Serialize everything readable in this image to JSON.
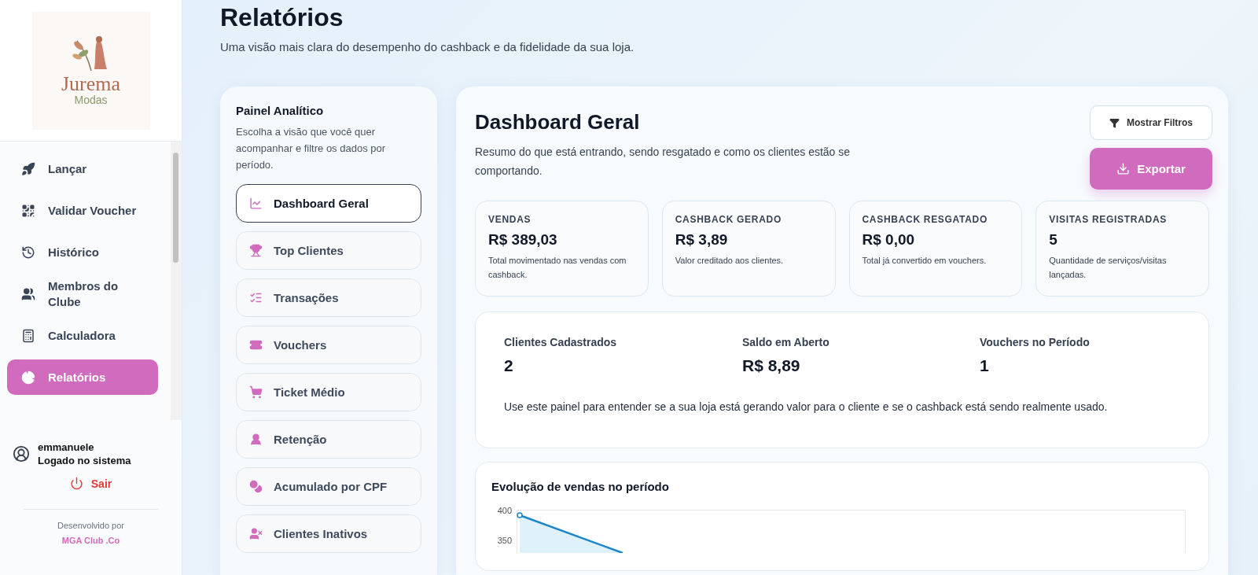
{
  "sidebar": {
    "logo": {
      "name": "Jurema",
      "tagline": "Modas"
    },
    "items": [
      {
        "label": "Lançar",
        "selected": false
      },
      {
        "label": "Validar Voucher",
        "selected": false
      },
      {
        "label": "Histórico",
        "selected": false
      },
      {
        "label": "Membros do Clube",
        "selected": false
      },
      {
        "label": "Calculadora",
        "selected": false
      },
      {
        "label": "Relatórios",
        "selected": true
      }
    ],
    "user": {
      "name": "emmanuele",
      "status": "Logado no sistema"
    },
    "logout": "Sair",
    "footer": {
      "text": "Desenvolvido por",
      "link": "MGA Club .Co"
    }
  },
  "page": {
    "title": "Relatórios",
    "subtitle": "Uma visão mais clara do desempenho do cashback e da fidelidade da sua loja."
  },
  "panel": {
    "title": "Painel Analítico",
    "description": "Escolha a visão que você quer acompanhar e filtre os dados por período.",
    "items": [
      {
        "label": "Dashboard Geral",
        "selected": true
      },
      {
        "label": "Top Clientes",
        "selected": false
      },
      {
        "label": "Transações",
        "selected": false
      },
      {
        "label": "Vouchers",
        "selected": false
      },
      {
        "label": "Ticket Médio",
        "selected": false
      },
      {
        "label": "Retenção",
        "selected": false
      },
      {
        "label": "Acumulado por CPF",
        "selected": false
      },
      {
        "label": "Clientes Inativos",
        "selected": false
      }
    ]
  },
  "dashboard": {
    "title": "Dashboard Geral",
    "description": "Resumo do que está entrando, sendo resgatado e como os clientes estão se comportando.",
    "buttons": [
      {
        "label": "Mostrar Filtros",
        "kind": "outline"
      },
      {
        "label": "Exportar",
        "kind": "primary"
      }
    ],
    "stats": [
      {
        "label": "VENDAS",
        "value": "R$ 389,03",
        "note": "Total movimentado nas vendas com cashback."
      },
      {
        "label": "CASHBACK GERADO",
        "value": "R$ 3,89",
        "note": "Valor creditado aos clientes."
      },
      {
        "label": "CASHBACK RESGATADO",
        "value": "R$ 0,00",
        "note": "Total já convertido em vouchers."
      },
      {
        "label": "VISITAS REGISTRADAS",
        "value": "5",
        "note": "Quantidade de serviços/visitas lançadas."
      }
    ],
    "summary": {
      "items": [
        {
          "label": "Clientes Cadastrados",
          "value": "2"
        },
        {
          "label": "Saldo em Aberto",
          "value": "R$ 8,89"
        },
        {
          "label": "Vouchers no Período",
          "value": "1"
        }
      ],
      "note": "Use este painel para entender se a sua loja está gerando valor para o cliente e se o cashback está sendo realmente usado."
    },
    "chart": {
      "title": "Evolução de vendas no período",
      "y_tick_labels": [
        "400",
        "350"
      ]
    }
  }
}
